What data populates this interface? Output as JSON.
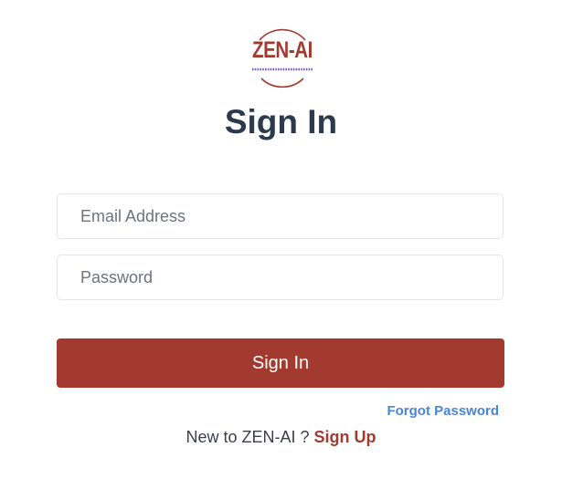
{
  "logo": {
    "text": "ZEN-AI",
    "color": "#a33a2f",
    "accent_color": "#6a5acd"
  },
  "title": "Sign In",
  "form": {
    "email_placeholder": "Email Address",
    "password_placeholder": "Password",
    "submit_label": "Sign In"
  },
  "links": {
    "forgot_password": "Forgot Password",
    "signup_prompt": "New to ZEN-AI ? ",
    "signup_label": "Sign Up"
  },
  "colors": {
    "brand": "#a33a2f",
    "link": "#4a86d6",
    "heading": "#2c3a4e"
  }
}
